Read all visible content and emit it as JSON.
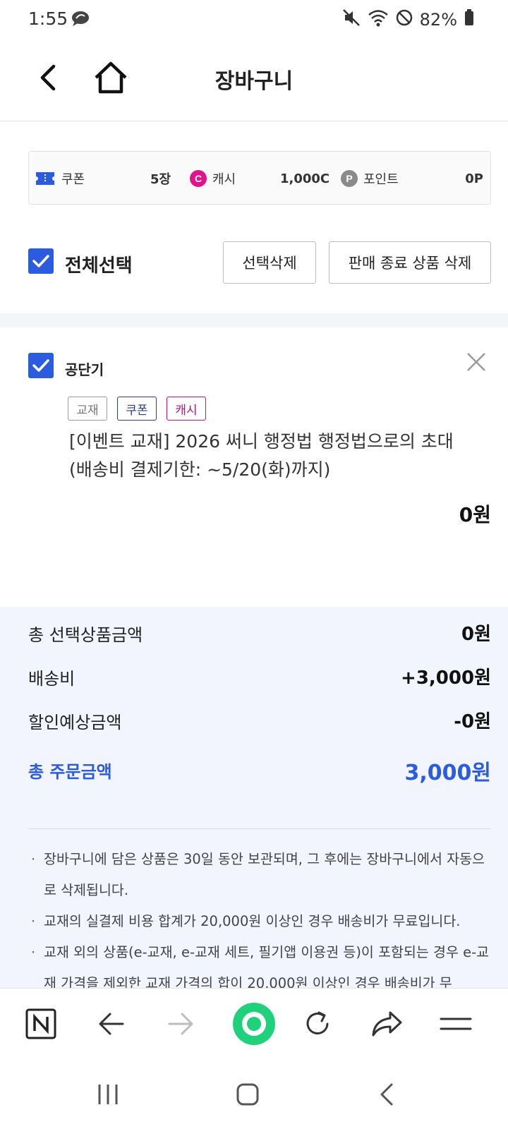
{
  "status_bar": {
    "time": "1:55",
    "battery": "82%"
  },
  "header": {
    "title": "장바구니"
  },
  "benefits": {
    "coupon_label": "쿠폰",
    "coupon_value": "5장",
    "cash_label": "캐시",
    "cash_value": "1,000C",
    "point_label": "포인트",
    "point_value": "0P",
    "cash_badge": "C",
    "point_badge": "P"
  },
  "selection": {
    "select_all_label": "전체선택",
    "delete_selected": "선택삭제",
    "delete_discontinued": "판매 종료 상품 삭제",
    "checked": true
  },
  "cart_item": {
    "seller": "공단기",
    "tags": [
      "교재",
      "쿠폰",
      "캐시"
    ],
    "title_line1": "[이벤트 교재] 2026 써니 행정법 행정법으로의 초대",
    "title_line2": "(배송비 결제기한: ~5/20(화)까지)",
    "price": "0원"
  },
  "summary": {
    "rows": [
      {
        "label": "총 선택상품금액",
        "value": "0원"
      },
      {
        "label": "배송비",
        "value": "+3,000원"
      },
      {
        "label": "할인예상금액",
        "value": "-0원"
      }
    ],
    "total_label": "총 주문금액",
    "total_value": "3,000원",
    "notes": [
      "장바구니에 담은 상품은 30일 동안 보관되며, 그 후에는 장바구니에서 자동으로 삭제됩니다.",
      "교재의 실결제 비용 합계가 20,000원 이상인 경우 배송비가 무료입니다.",
      "교재 외의 상품(e-교재, e-교재 세트, 필기앱 이용권 등)이 포함되는 경우 e-교재 가격을 제외한 교재 가격의 합이 20,000원 이상인 경우 배송비가 무"
    ]
  },
  "colors": {
    "accent": "#2b5bdf",
    "cash": "#e0138c",
    "point": "#8a8a8a",
    "green": "#1fd17a"
  }
}
